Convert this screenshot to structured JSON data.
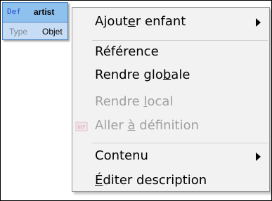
{
  "node": {
    "kind": "Def",
    "name": "artist",
    "type_label": "Type",
    "type_value": "Objet"
  },
  "menu": {
    "items": [
      {
        "label": "Ajouter enfant",
        "accel": "e",
        "enabled": true,
        "submenu": true
      },
      {
        "label": "Référence",
        "accel": "",
        "enabled": true,
        "submenu": false
      },
      {
        "label": "Rendre globale",
        "accel": "b",
        "enabled": true,
        "submenu": false
      },
      {
        "label": "Rendre local",
        "accel": "l",
        "enabled": false,
        "submenu": false
      },
      {
        "label": "Aller à définition",
        "accel": "à",
        "enabled": false,
        "submenu": false,
        "icon": "definition-icon"
      },
      {
        "label": "Contenu",
        "accel": "",
        "enabled": true,
        "submenu": true
      },
      {
        "label": "Éditer description",
        "accel": "É",
        "enabled": true,
        "submenu": false
      }
    ]
  },
  "colors": {
    "node_header": "#8fc1ef",
    "node_row": "#c7ddf5",
    "node_border": "#4a84c0",
    "def_keyword": "#1f4fd6",
    "menu_background": "#f2f2f2",
    "disabled_text": "#a0a0a0"
  }
}
